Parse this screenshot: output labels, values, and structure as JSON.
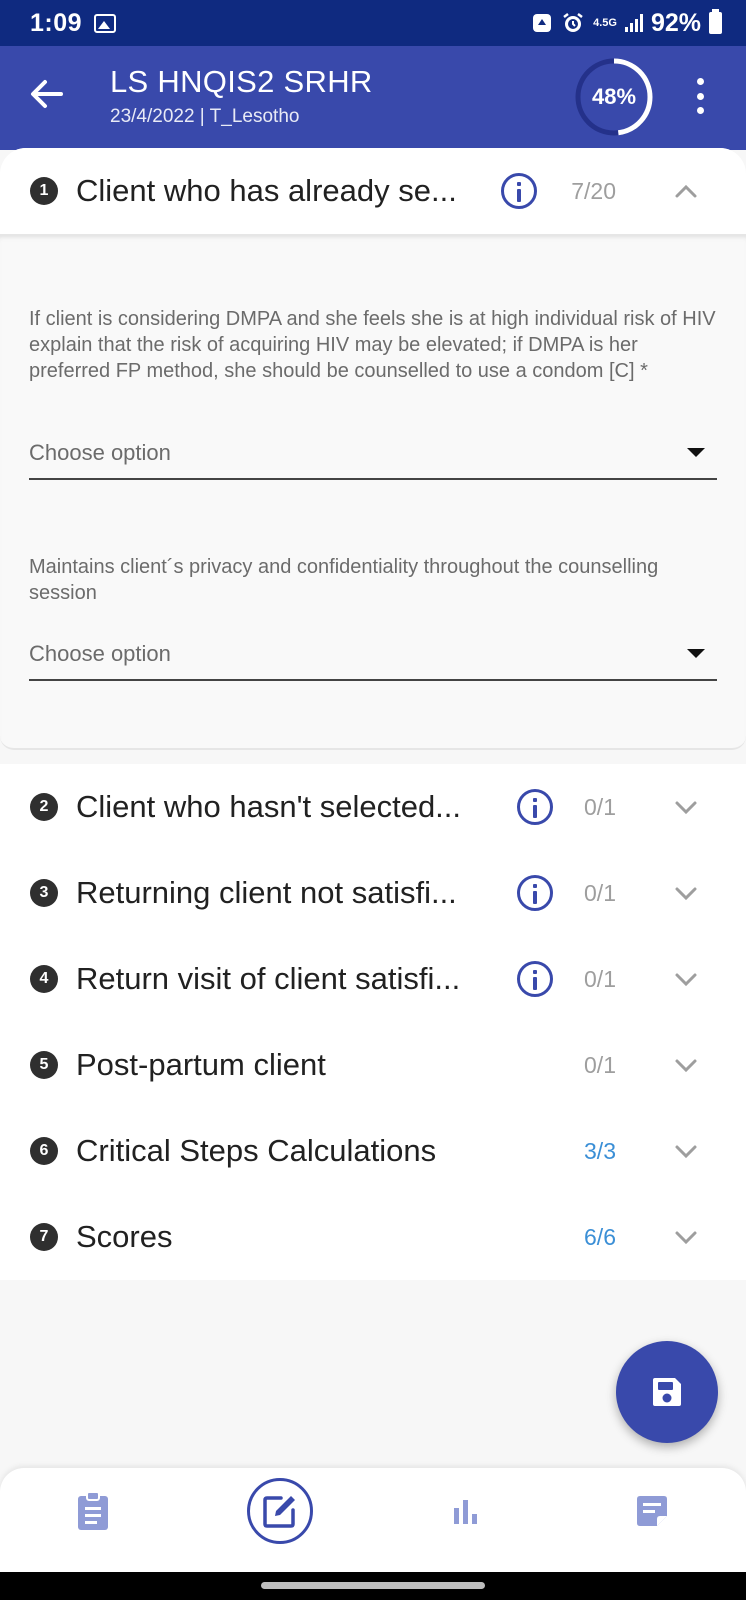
{
  "status_bar": {
    "time": "1:09",
    "network_label": "4.5G",
    "battery": "92%"
  },
  "header": {
    "title": "LS HNQIS2 SRHR",
    "subtitle": "23/4/2022 | T_Lesotho",
    "progress": "48%",
    "progress_fraction": 0.48
  },
  "sections": [
    {
      "number": "1",
      "title": "Client who has already se...",
      "count": "7/20",
      "has_info": true,
      "expanded": true
    },
    {
      "number": "2",
      "title": "Client who hasn't selected...",
      "count": "0/1",
      "has_info": true,
      "expanded": false
    },
    {
      "number": "3",
      "title": "Returning client not satisfi...",
      "count": "0/1",
      "has_info": true,
      "expanded": false
    },
    {
      "number": "4",
      "title": "Return visit of client satisfi...",
      "count": "0/1",
      "has_info": true,
      "expanded": false
    },
    {
      "number": "5",
      "title": "Post-partum client",
      "count": "0/1",
      "has_info": false,
      "expanded": false
    },
    {
      "number": "6",
      "title": "Critical Steps Calculations",
      "count": "3/3",
      "has_info": false,
      "expanded": false
    },
    {
      "number": "7",
      "title": "Scores",
      "count": "6/6",
      "has_info": false,
      "expanded": false
    }
  ],
  "questions": [
    {
      "text": "If client is considering DMPA and she feels she is at high individual risk of HIV explain that the risk of acquiring HIV may be elevated; if DMPA is her preferred FP method, she should be counselled to use a condom [C] *",
      "placeholder": "Choose option"
    },
    {
      "text": "Maintains client´s privacy and confidentiality throughout the counselling session",
      "placeholder": "Choose option"
    }
  ],
  "colors": {
    "status_bar": "#0f2a80",
    "primary": "#3949ab",
    "complete_count": "#3b8fd6",
    "pending_count": "#9e9e9e"
  },
  "icons": {
    "back": "arrow-left-icon",
    "more": "more-vert-icon",
    "info": "info-icon",
    "fab": "save-icon",
    "nav": [
      "clipboard-icon",
      "edit-icon",
      "bar-chart-icon",
      "notes-icon"
    ]
  }
}
